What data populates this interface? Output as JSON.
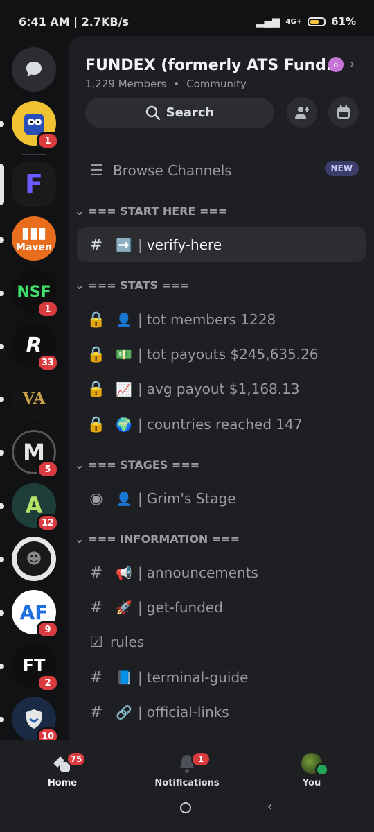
{
  "status_bar": {
    "time_speed": "6:41 AM | 2.7KB/s",
    "network": "4G+",
    "battery": "61%"
  },
  "servers": [
    {
      "abbr": "",
      "badge": "1",
      "color": "#f1c232"
    },
    {
      "abbr": "F",
      "badge": "",
      "color": "#1a1a1a"
    },
    {
      "abbr": "Maven",
      "badge": "",
      "color": "#e86d1c"
    },
    {
      "abbr": "NSF",
      "badge": "1",
      "color": "#0f0f0f"
    },
    {
      "abbr": "R",
      "badge": "33",
      "color": "#0f0f0f"
    },
    {
      "abbr": "VA",
      "badge": "",
      "color": "#141414"
    },
    {
      "abbr": "M",
      "badge": "5",
      "color": "#141414"
    },
    {
      "abbr": "A",
      "badge": "12",
      "color": "#1e3f37"
    },
    {
      "abbr": "",
      "badge": "",
      "color": "#e6e6e6"
    },
    {
      "abbr": "AF",
      "badge": "9",
      "color": "#ffffff"
    },
    {
      "abbr": "FT",
      "badge": "2",
      "color": "#0f0f0f"
    },
    {
      "abbr": "",
      "badge": "10",
      "color": "#1b2a44"
    }
  ],
  "server": {
    "name": "FUNDEX (formerly ATS Fund...",
    "members": "1,229 Members",
    "type": "Community"
  },
  "search": {
    "label": "Search"
  },
  "browse": {
    "label": "Browse Channels",
    "tag": "NEW"
  },
  "categories": {
    "start": "=== START HERE ===",
    "stats": "=== STATS ===",
    "stages": "=== STAGES ===",
    "info": "=== INFORMATION ==="
  },
  "channels": {
    "verify": {
      "emoji": "➡️",
      "name": "verify-here"
    },
    "members": {
      "emoji": "👤",
      "name": "tot members 1228"
    },
    "payouts": {
      "emoji": "💵",
      "name": "tot payouts $245,635.26"
    },
    "avg": {
      "emoji": "📈",
      "name": "avg payout $1,168.13"
    },
    "countries": {
      "emoji": "🌍",
      "name": "countries reached 147"
    },
    "stage": {
      "emoji": "👤",
      "name": "Grim's Stage"
    },
    "announcements": {
      "emoji": "📢",
      "name": "announcements"
    },
    "funded": {
      "emoji": "🚀",
      "name": "get-funded"
    },
    "rules": {
      "name": "rules"
    },
    "terminal": {
      "emoji": "📘",
      "name": "terminal-guide"
    },
    "links": {
      "emoji": "🔗",
      "name": "official-links"
    }
  },
  "bottom_nav": {
    "home": {
      "label": "Home",
      "badge": "75"
    },
    "notifications": {
      "label": "Notifications",
      "badge": "1"
    },
    "you": {
      "label": "You"
    }
  }
}
